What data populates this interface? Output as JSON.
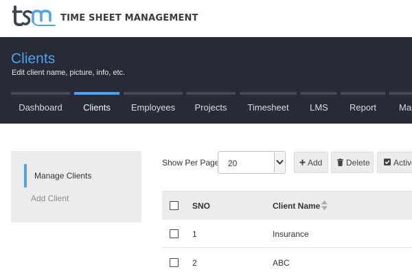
{
  "brand": {
    "logo_text": "tsm",
    "title": "TIME SHEET MANAGEMENT"
  },
  "header": {
    "title": "Clients",
    "subtitle": "Edit client name, picture, info, etc."
  },
  "tabs": [
    {
      "label": "Dashboard",
      "active": false
    },
    {
      "label": "Clients",
      "active": true
    },
    {
      "label": "Employees",
      "active": false
    },
    {
      "label": "Projects",
      "active": false
    },
    {
      "label": "Timesheet",
      "active": false
    },
    {
      "label": "LMS",
      "active": false
    },
    {
      "label": "Report",
      "active": false
    },
    {
      "label": "Mas",
      "active": false
    }
  ],
  "sidebar": {
    "items": [
      {
        "label": "Manage Clients",
        "active": true
      },
      {
        "label": "Add Client",
        "active": false
      }
    ]
  },
  "toolbar": {
    "show_per_page_label": "Show Per Page",
    "per_page_value": "20",
    "add_label": "Add",
    "delete_label": "Delete",
    "active_label": "Active"
  },
  "table": {
    "columns": [
      "SNO",
      "Client Name"
    ],
    "rows": [
      {
        "sno": "1",
        "client_name": "Insurance"
      },
      {
        "sno": "2",
        "client_name": "ABC"
      }
    ]
  },
  "colors": {
    "accent": "#4ba3f0",
    "header_bg": "#262b35",
    "panel_bg": "#ececec"
  }
}
